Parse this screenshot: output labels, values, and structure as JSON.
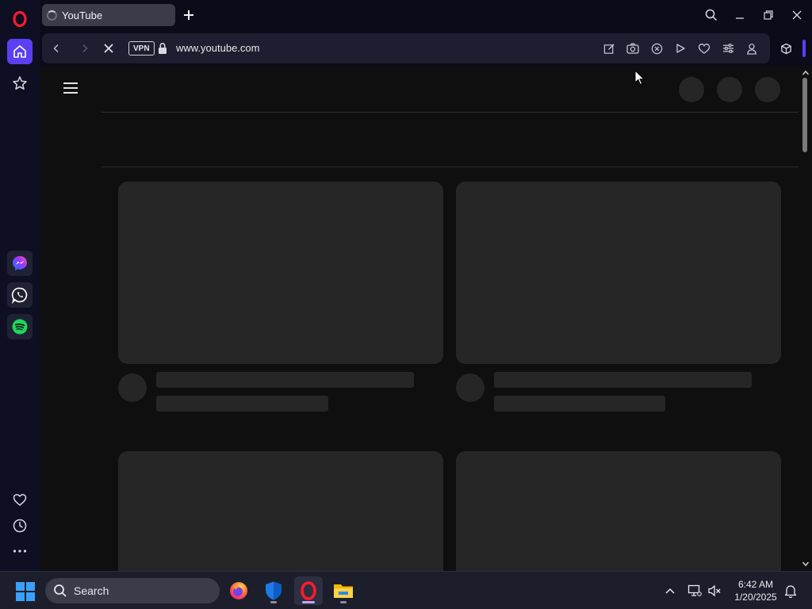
{
  "browser": {
    "tab_title": "YouTube",
    "url": "www.youtube.com",
    "vpn_label": "VPN",
    "accent_color": "#5b3ff2"
  },
  "sidebar": {
    "items": [
      {
        "name": "home",
        "icon": "home-icon",
        "active": true
      },
      {
        "name": "pinboards",
        "icon": "star-icon"
      },
      {
        "name": "messenger",
        "icon": "messenger-icon"
      },
      {
        "name": "whatsapp",
        "icon": "whatsapp-icon"
      },
      {
        "name": "spotify",
        "icon": "spotify-icon"
      },
      {
        "name": "bookmarks",
        "icon": "heart-icon"
      },
      {
        "name": "history",
        "icon": "clock-icon"
      },
      {
        "name": "more",
        "icon": "more-icon"
      }
    ]
  },
  "taskbar": {
    "search_placeholder": "Search",
    "apps": [
      "firefox-icon",
      "windows-security-icon",
      "opera-icon",
      "file-explorer-icon"
    ],
    "time": "6:42 AM",
    "date": "1/20/2025"
  }
}
